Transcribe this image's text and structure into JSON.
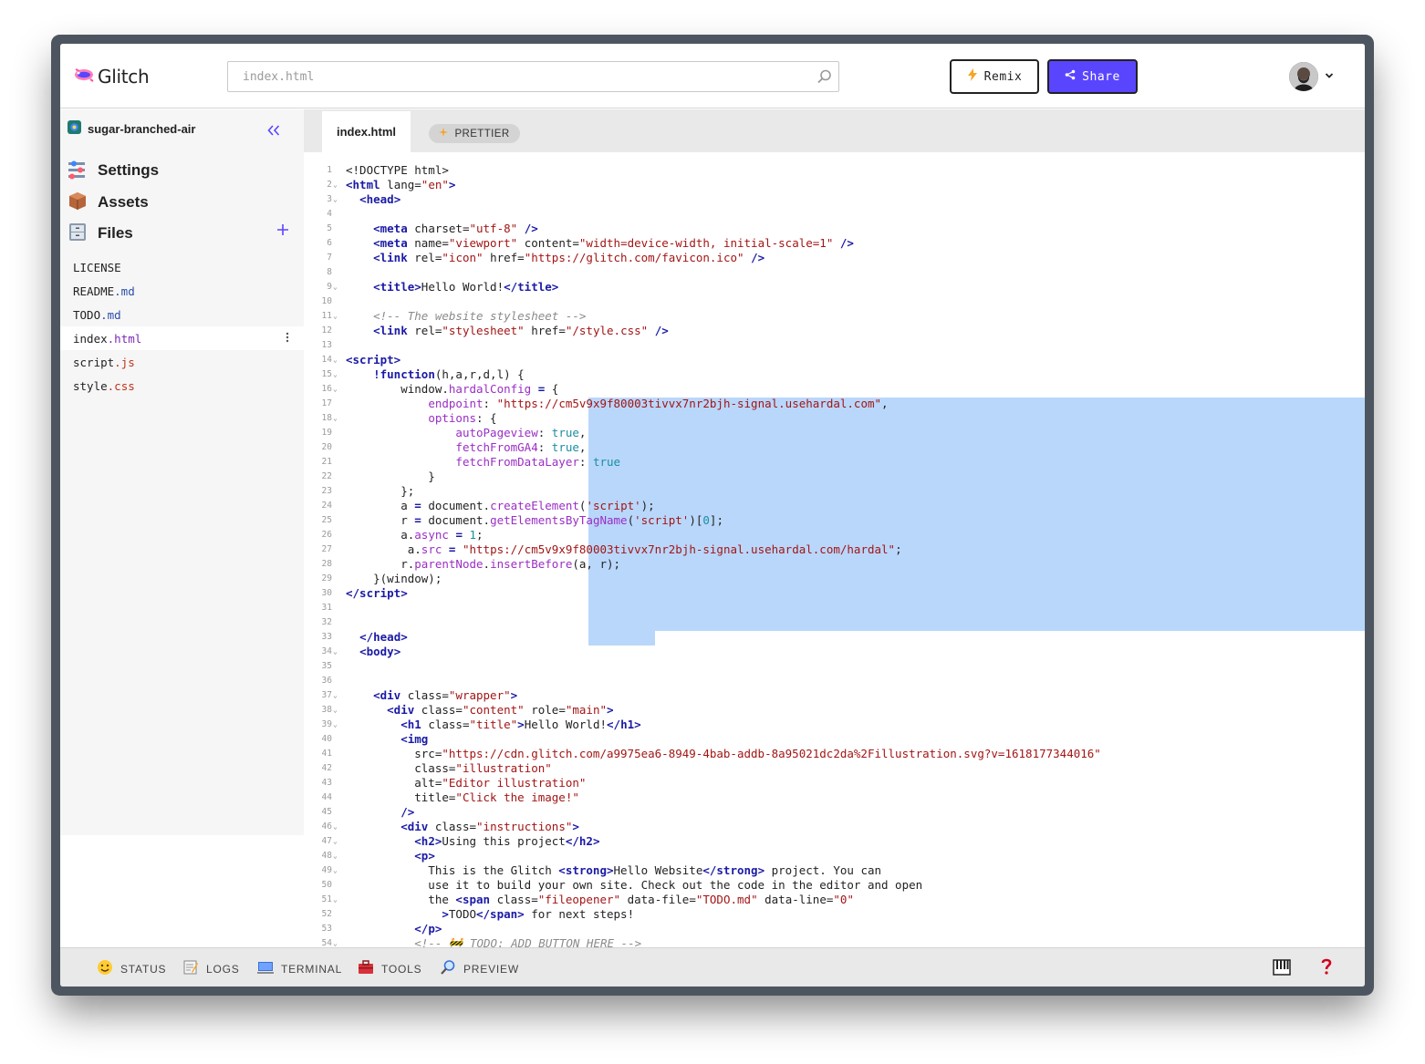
{
  "app": {
    "name": "Glitch"
  },
  "search": {
    "placeholder": "index.html"
  },
  "header": {
    "remix_label": "Remix",
    "share_label": "Share"
  },
  "sidebar": {
    "project_name": "sugar-branched-air",
    "nav": [
      {
        "label": "Settings"
      },
      {
        "label": "Assets"
      },
      {
        "label": "Files"
      }
    ],
    "files": [
      {
        "base": "LICENSE",
        "ext": ""
      },
      {
        "base": "README",
        "ext": ".md"
      },
      {
        "base": "TODO",
        "ext": ".md"
      },
      {
        "base": "index",
        "ext": ".html"
      },
      {
        "base": "script",
        "ext": ".js"
      },
      {
        "base": "style",
        "ext": ".css"
      }
    ]
  },
  "editor": {
    "tab_label": "index.html",
    "prettier_label": "PRETTIER",
    "line_numbers": [
      "1",
      "2",
      "3",
      "4",
      "5",
      "6",
      "7",
      "8",
      "9",
      "10",
      "11",
      "12",
      "13",
      "14",
      "15",
      "16",
      "17",
      "18",
      "19",
      "20",
      "21",
      "22",
      "23",
      "24",
      "25",
      "26",
      "27",
      "28",
      "29",
      "30",
      "31",
      "32",
      "33",
      "34",
      "35",
      "36",
      "37",
      "38",
      "39",
      "40",
      "41",
      "42",
      "43",
      "44",
      "45",
      "46",
      "47",
      "48",
      "49",
      "50",
      "51",
      "52",
      "53",
      "54"
    ]
  },
  "footer": {
    "status": "STATUS",
    "logs": "LOGS",
    "terminal": "TERMINAL",
    "tools": "TOOLS",
    "preview": "PREVIEW"
  },
  "colors": {
    "accent": "#5a45ff",
    "selection": "#b9d7fb",
    "tag": "#1a1aa6",
    "string": "#a31515",
    "property": "#9a2ec4"
  },
  "icons": [
    "glitch-logo-icon",
    "search-icon",
    "lightning-icon",
    "share-icon",
    "chevron-down-icon",
    "project-icon",
    "collapse-icon",
    "settings-icon",
    "assets-icon",
    "files-icon",
    "add-icon",
    "kebab-icon",
    "sparkle-icon",
    "status-icon",
    "logs-icon",
    "terminal-icon",
    "tools-icon",
    "preview-icon",
    "keyboard-icon",
    "help-icon"
  ]
}
